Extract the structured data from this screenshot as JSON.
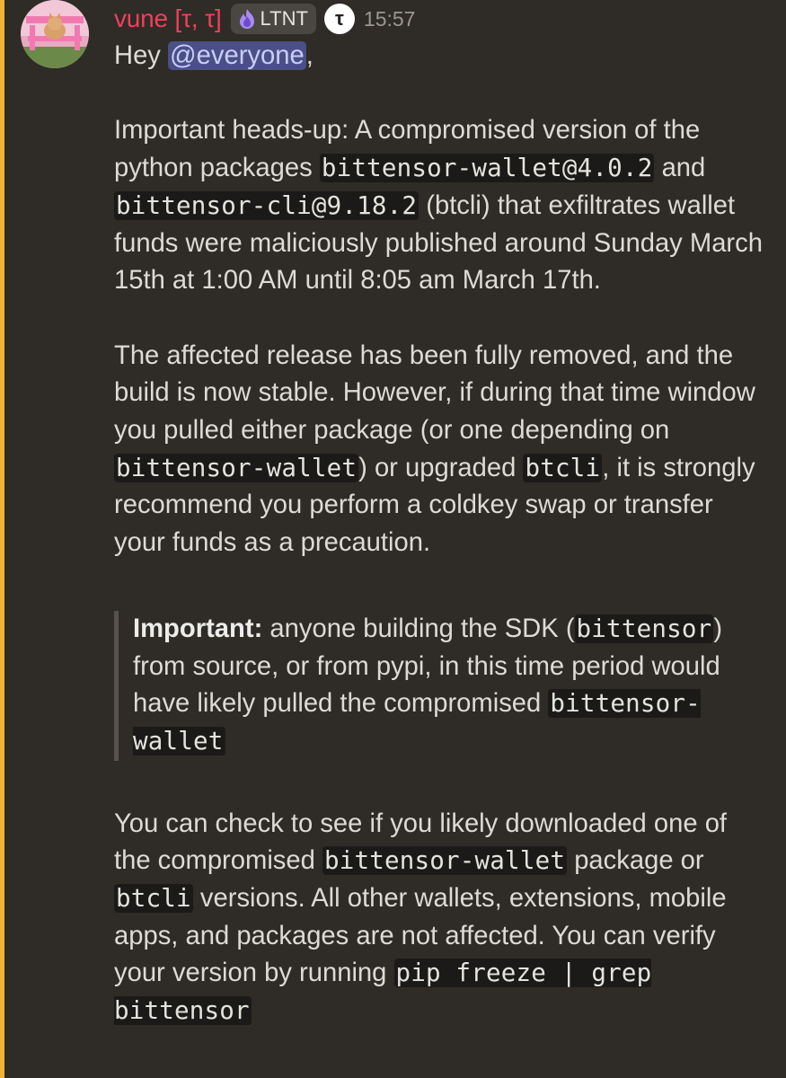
{
  "message": {
    "author": "vune [τ, τ]",
    "role_badge": "LTNT",
    "role_icon": "purple-flame-icon",
    "tao_badge": "τ",
    "timestamp": "15:57",
    "accent_color": "#f0b232",
    "author_color": "#f23f5d",
    "greeting_prefix": "Hey ",
    "mention": "@everyone",
    "greeting_suffix": ",",
    "para1": {
      "t1": "Important heads-up: A compromised version of the python packages ",
      "c1": "bittensor-wallet@4.0.2",
      "t2": " and ",
      "c2": "bittensor-cli@9.18.2",
      "t3": " (btcli) that exfiltrates wallet funds were maliciously published around Sunday March 15th at 1:00 AM until 8:05 am March 17th."
    },
    "para2": {
      "t1": "The affected release has been fully removed, and the build is now stable. However, if during that time window you pulled either package (or one depending on ",
      "c1": "bittensor-wallet",
      "t2": ") or upgraded ",
      "c2": "btcli",
      "t3": ", it is strongly recommend you perform a coldkey swap or transfer your funds as a precaution."
    },
    "quote": {
      "bold": "Important:",
      "t1": " anyone building the SDK (",
      "c1": "bittensor",
      "t2": ") from source, or from pypi, in this time period would have likely pulled the compromised ",
      "c2": "bittensor-wallet"
    },
    "para3": {
      "t1": "You can check to see if you likely downloaded one of the compromised ",
      "c1": "bittensor-wallet",
      "t2": " package or ",
      "c2": "btcli",
      "t3": " versions. All other wallets, extensions, mobile apps, and packages are not affected. You can verify your version by running ",
      "c3": "pip freeze | grep bittensor"
    }
  }
}
